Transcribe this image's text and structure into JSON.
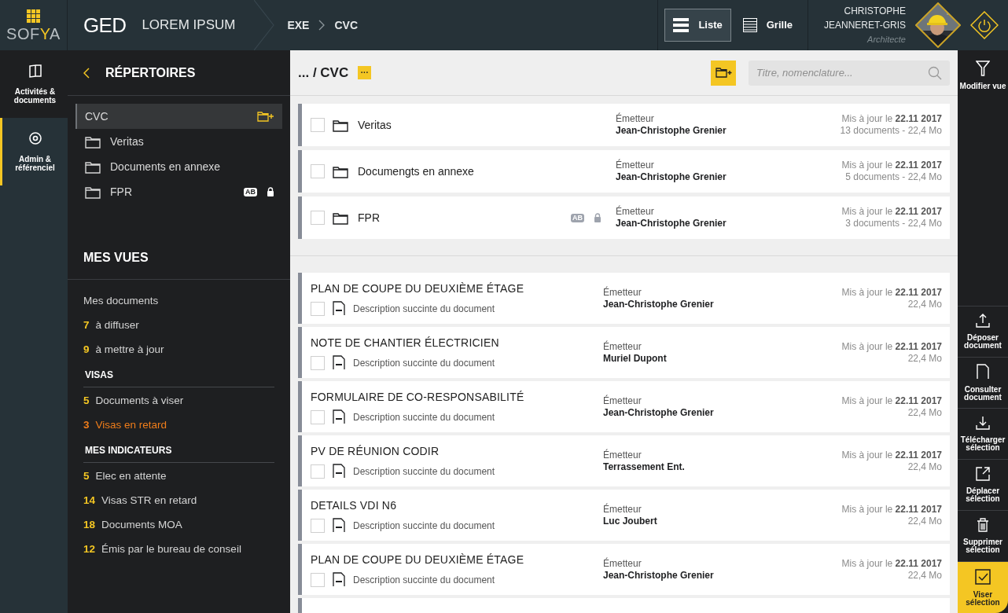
{
  "app": {
    "logo": [
      "SOF",
      "Y",
      "A"
    ],
    "module": "GED",
    "project": "LOREM IPSUM",
    "breadcrumb": [
      "EXE",
      "CVC"
    ]
  },
  "view_toggle": [
    {
      "label": "Liste",
      "kind": "list",
      "selected": true
    },
    {
      "label": "Grille",
      "kind": "grid",
      "selected": false
    }
  ],
  "user": {
    "name_lines": [
      "CHRISTOPHE",
      "JEANNERET-GRIS"
    ],
    "role": "Architecte"
  },
  "nav": [
    {
      "label": "Activités & documents",
      "kind": "book",
      "selected": true,
      "accent": false
    },
    {
      "label": "Admin & référenciel",
      "kind": "gear",
      "selected": false,
      "accent": true
    }
  ],
  "sidebar": {
    "title": "RÉPERTOIRES",
    "folders": [
      {
        "name": "CVC",
        "selected": true,
        "locked": false
      },
      {
        "name": "Veritas",
        "selected": false,
        "locked": false
      },
      {
        "name": "Documents en annexe",
        "selected": false,
        "locked": false
      },
      {
        "name": "FPR",
        "selected": false,
        "badge": "AB",
        "locked": true
      }
    ],
    "views_title": "MES VUES",
    "groups": [
      {
        "items": [
          {
            "label": "Mes documents",
            "alert": false
          },
          {
            "count": "7",
            "label": "à diffuser",
            "alert": false
          },
          {
            "count": "9",
            "label": "à mettre à jour",
            "alert": false
          }
        ]
      },
      {
        "heading": "VISAS",
        "items": [
          {
            "count": "5",
            "label": "Documents à viser",
            "alert": false
          },
          {
            "count": "3",
            "label": "Visas en retard",
            "alert": true
          }
        ]
      },
      {
        "heading": "MES INDICATEURS",
        "items": [
          {
            "count": "5",
            "label": "Elec en attente",
            "alert": false
          },
          {
            "count": "14",
            "label": "Visas STR en retard",
            "alert": false
          },
          {
            "count": "18",
            "label": "Documents MOA",
            "alert": false
          },
          {
            "count": "12",
            "label": "Émis par le bureau de conseil",
            "alert": false
          }
        ]
      }
    ]
  },
  "main": {
    "path": "... / CVC",
    "more": "···",
    "search_placeholder": "Titre, nomenclature...",
    "folders": [
      {
        "name": "Veritas",
        "checked": false,
        "locked": false,
        "sender_label": "Émetteur",
        "sender": "Jean-Christophe Grenier",
        "updated": "Mis à jour le **22.11 2017**",
        "info": "13 documents - 22,4 Mo"
      },
      {
        "name": "Documengts en annexe",
        "checked": false,
        "locked": false,
        "sender_label": "Émetteur",
        "sender": "Jean-Christophe Grenier",
        "updated": "Mis à jour le **22.11 2017**",
        "info": "5 documents - 22,4 Mo"
      },
      {
        "name": "FPR",
        "checked": false,
        "badge": "AB",
        "locked": true,
        "sender_label": "Émetteur",
        "sender": "Jean-Christophe Grenier",
        "updated": "Mis à jour le **22.11 2017**",
        "info": "3 documents - 22,4 Mo"
      }
    ],
    "documents": [
      {
        "title": "PLAN DE COUPE DU DEUXIÈME ÉTAGE",
        "description": "Description succinte du document",
        "checked": false,
        "sender_label": "Émetteur",
        "sender": "Jean-Christophe Grenier",
        "updated": "Mis à jour le **22.11 2017**",
        "info": "22,4 Mo"
      },
      {
        "title": "NOTE DE CHANTIER ÉLECTRICIEN",
        "description": "Description succinte du document",
        "checked": false,
        "sender_label": "Émetteur",
        "sender": "Muriel Dupont",
        "updated": "Mis à jour le **22.11 2017**",
        "info": "22,4 Mo"
      },
      {
        "title": "FORMULAIRE DE CO-RESPONSABILITÉ",
        "description": "Description succinte du document",
        "checked": false,
        "sender_label": "Émetteur",
        "sender": "Jean-Christophe Grenier",
        "updated": "Mis à jour le **22.11 2017**",
        "info": "22,4 Mo"
      },
      {
        "title": "PV DE RÉUNION CODIR",
        "description": "Description succinte du document",
        "checked": false,
        "sender_label": "Émetteur",
        "sender": "Terrassement Ent.",
        "updated": "Mis à jour le **22.11 2017**",
        "info": "22,4 Mo"
      },
      {
        "title": "DETAILS VDI N6",
        "description": "Description succinte du document",
        "checked": false,
        "sender_label": "Émetteur",
        "sender": "Luc Joubert",
        "updated": "Mis à jour le **22.11 2017**",
        "info": "22,4 Mo"
      },
      {
        "title": "PLAN DE COUPE DU DEUXIÈME ÉTAGE",
        "description": "Description succinte du document",
        "checked": false,
        "sender_label": "Émetteur",
        "sender": "Jean-Christophe Grenier",
        "updated": "Mis à jour le **22.11 2017**",
        "info": "22,4 Mo"
      }
    ]
  },
  "toolbar": {
    "view_action": {
      "label": "Modifier vue",
      "kind": "filter"
    },
    "actions": [
      {
        "label": "Déposer document",
        "kind": "upload",
        "primary": false
      },
      {
        "label": "Consulter document",
        "kind": "file",
        "primary": false
      },
      {
        "label": "Télécharger sélection",
        "kind": "download",
        "primary": false
      },
      {
        "label": "Déplacer sélection",
        "kind": "move",
        "primary": false
      },
      {
        "label": "Supprimer sélection",
        "kind": "trash",
        "primary": false
      },
      {
        "label": "Viser sélection",
        "kind": "check",
        "primary": true
      }
    ]
  }
}
